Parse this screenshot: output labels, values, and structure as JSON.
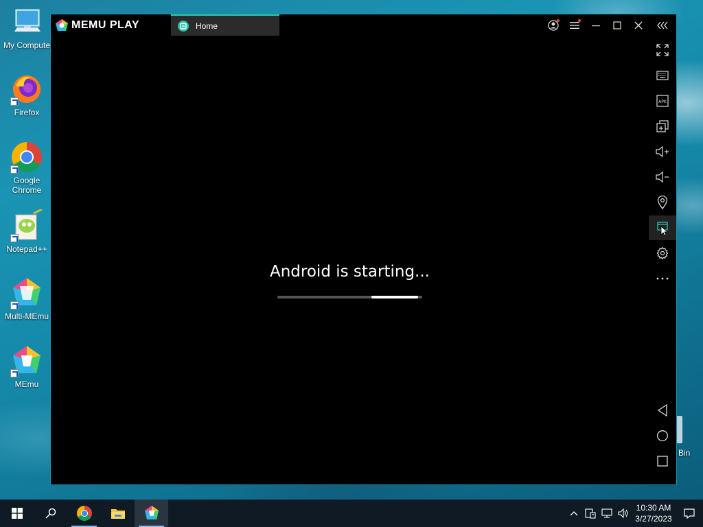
{
  "desktop": {
    "icons": [
      {
        "label": "My Compute"
      },
      {
        "label": "Firefox"
      },
      {
        "label": "Google Chrome"
      },
      {
        "label": "Notepad++"
      },
      {
        "label": "Multi-MEmu"
      },
      {
        "label": "MEmu"
      }
    ],
    "recycle_bin_label": "Bin"
  },
  "window": {
    "brand": "MEMU PLAY",
    "tab_label": "Home",
    "accent_color": "#2bc3a8",
    "boot_message": "Android is starting...",
    "boot_progress": {
      "start": 0.65,
      "end": 0.97
    }
  },
  "sidebar": {
    "items": [
      "fullscreen-icon",
      "keyboard-icon",
      "apk-icon",
      "multi-window-icon",
      "volume-up-icon",
      "volume-down-icon",
      "location-icon",
      "screenshot-icon",
      "settings-icon",
      "more-icon"
    ],
    "nav": [
      "back-icon",
      "home-icon",
      "recents-icon"
    ],
    "active": "screenshot-icon"
  },
  "taskbar": {
    "time": "10:30 AM",
    "date": "3/27/2023"
  }
}
